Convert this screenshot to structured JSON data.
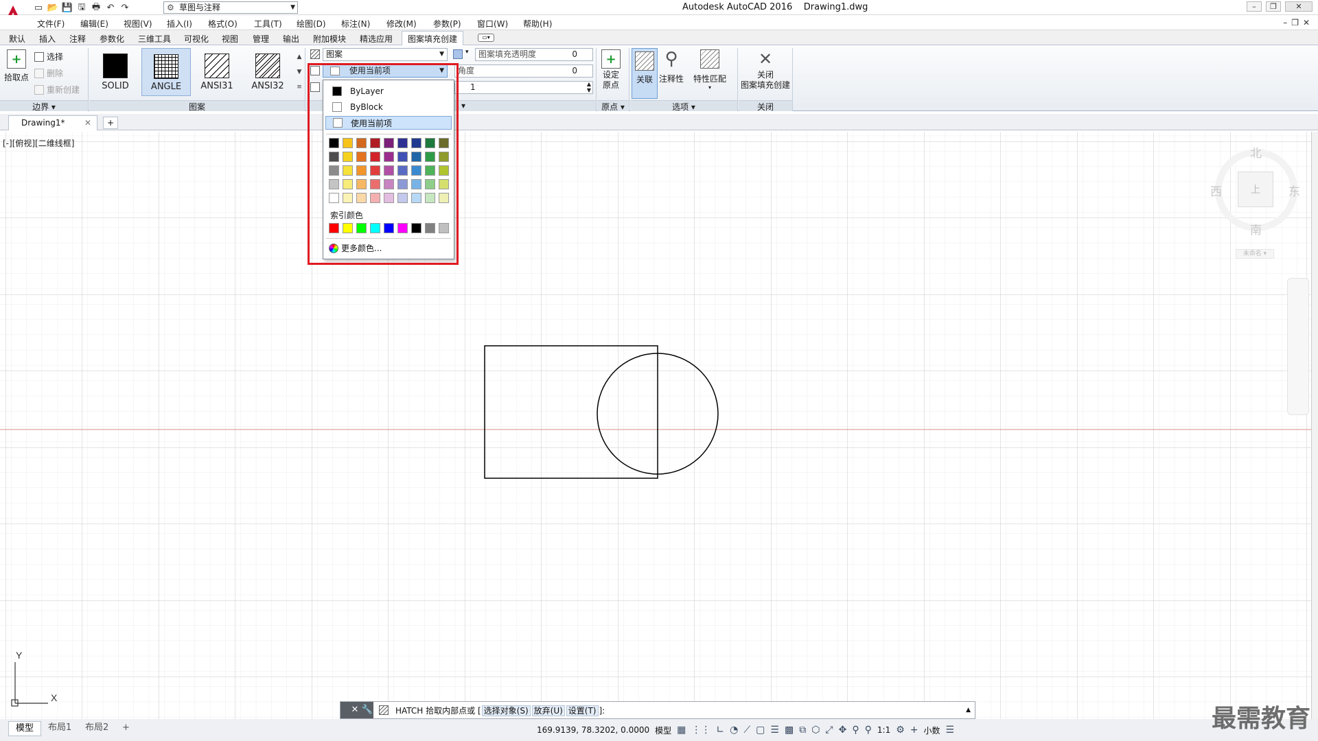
{
  "titlebar": {
    "workspace": "草图与注释",
    "app_title": "Autodesk AutoCAD 2016",
    "file_name": "Drawing1.dwg"
  },
  "menu": [
    "文件(F)",
    "编辑(E)",
    "视图(V)",
    "插入(I)",
    "格式(O)",
    "工具(T)",
    "绘图(D)",
    "标注(N)",
    "修改(M)",
    "参数(P)",
    "窗口(W)",
    "帮助(H)"
  ],
  "ribbon_tabs": [
    "默认",
    "插入",
    "注释",
    "参数化",
    "三维工具",
    "可视化",
    "视图",
    "管理",
    "输出",
    "附加模块",
    "精选应用",
    "图案填充创建"
  ],
  "ribbon": {
    "boundary": {
      "pick_points": "拾取点",
      "select": "选择",
      "remove": "删除",
      "recreate": "重新创建",
      "panel_title": "边界"
    },
    "pattern": {
      "swatches": [
        "SOLID",
        "ANGLE",
        "ANSI31",
        "ANSI32"
      ],
      "selected": "ANGLE",
      "panel_title": "图案"
    },
    "properties": {
      "type": "图案",
      "color": "使用当前项",
      "transparency_label": "图案填充透明度",
      "transparency_value": "0",
      "angle_label": "角度",
      "angle_value": "0",
      "scale_value": "1"
    },
    "origin": {
      "set_origin": "设定\n原点",
      "panel_title": "原点"
    },
    "options": {
      "associative": "关联",
      "annotative": "注释性",
      "match_properties": "特性匹配",
      "panel_title": "选项"
    },
    "close": {
      "label": "关闭\n图案填充创建",
      "panel_title": "关闭"
    }
  },
  "doc_tabs": {
    "active": "Drawing1*"
  },
  "viewport_label": "[-][俯视][二维线框]",
  "viewcube": {
    "north": "北",
    "south": "南",
    "east": "东",
    "west": "西",
    "face": "上",
    "wcs": "未命名"
  },
  "color_dropdown": {
    "items": [
      "ByLayer",
      "ByBlock",
      "使用当前项"
    ],
    "item_colors": [
      "#000000",
      "#ffffff",
      "#ffffff"
    ],
    "highlighted": "使用当前项",
    "palette": [
      [
        "#000000",
        "#f7c31a",
        "#d2691e",
        "#b01e23",
        "#7b1f7a",
        "#2e3192",
        "#1f3a8f",
        "#1e7a3c",
        "#6b6b2a"
      ],
      [
        "#4d4d4d",
        "#f5d21e",
        "#e47320",
        "#d2232a",
        "#9b2d8e",
        "#3f51b5",
        "#2166a8",
        "#2e9b47",
        "#8f9b2c"
      ],
      [
        "#8c8c8c",
        "#f5e23a",
        "#f2962b",
        "#e23d3d",
        "#b04fa4",
        "#5a6bc4",
        "#3b8ad0",
        "#4fb35a",
        "#b0c430"
      ],
      [
        "#c4c4c4",
        "#f7eb7a",
        "#f7b865",
        "#ea6e6e",
        "#c884c0",
        "#8d98d6",
        "#79b3e6",
        "#8fce8a",
        "#d4df6e"
      ],
      [
        "#ffffff",
        "#fbf3b6",
        "#fbd8a8",
        "#f4b0b0",
        "#e3bde0",
        "#c3c9ec",
        "#b7d9f5",
        "#c6e7c1",
        "#eef0b4"
      ]
    ],
    "index_label": "索引颜色",
    "index_colors": [
      "#ff0000",
      "#ffff00",
      "#00ff00",
      "#00ffff",
      "#0000ff",
      "#ff00ff",
      "#000000",
      "#808080",
      "#c0c0c0"
    ],
    "more_colors": "更多颜色..."
  },
  "command_line": {
    "prompt": "HATCH 拾取内部点或 [",
    "options": [
      "选择对象(S)",
      "放弃(U)",
      "设置(T)"
    ],
    "suffix": "]:"
  },
  "layout_tabs": [
    "模型",
    "布局1",
    "布局2"
  ],
  "status": {
    "coordinates": "169.9139, 78.3202, 0.0000",
    "space": "模型",
    "scale": "1:1",
    "units": "小数"
  },
  "watermark": "最需教育"
}
